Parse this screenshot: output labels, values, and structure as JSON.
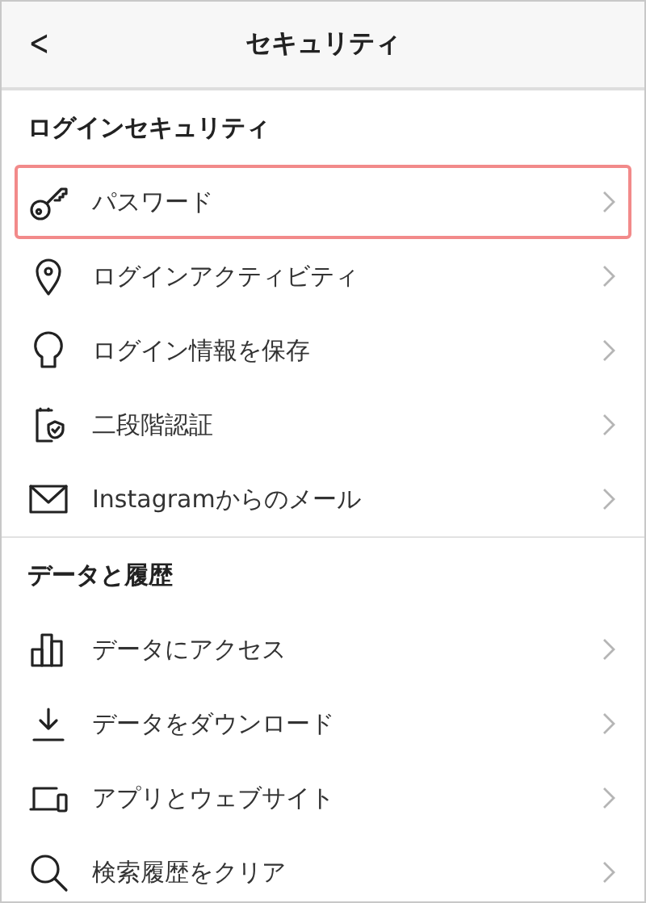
{
  "header": {
    "back": "<",
    "title": "セキュリティ"
  },
  "sections": [
    {
      "heading": "ログインセキュリティ",
      "items": [
        {
          "kind": "key",
          "label": "パスワード",
          "highlighted": true
        },
        {
          "kind": "pin",
          "label": "ログインアクティビティ",
          "highlighted": false
        },
        {
          "kind": "keyhole",
          "label": "ログイン情報を保存",
          "highlighted": false
        },
        {
          "kind": "shield",
          "label": "二段階認証",
          "highlighted": false
        },
        {
          "kind": "mail",
          "label": "Instagramからのメール",
          "highlighted": false
        }
      ]
    },
    {
      "heading": "データと履歴",
      "items": [
        {
          "kind": "bars",
          "label": "データにアクセス",
          "highlighted": false
        },
        {
          "kind": "download",
          "label": "データをダウンロード",
          "highlighted": false
        },
        {
          "kind": "devices",
          "label": "アプリとウェブサイト",
          "highlighted": false
        },
        {
          "kind": "search",
          "label": "検索履歴をクリア",
          "highlighted": false
        }
      ]
    }
  ]
}
